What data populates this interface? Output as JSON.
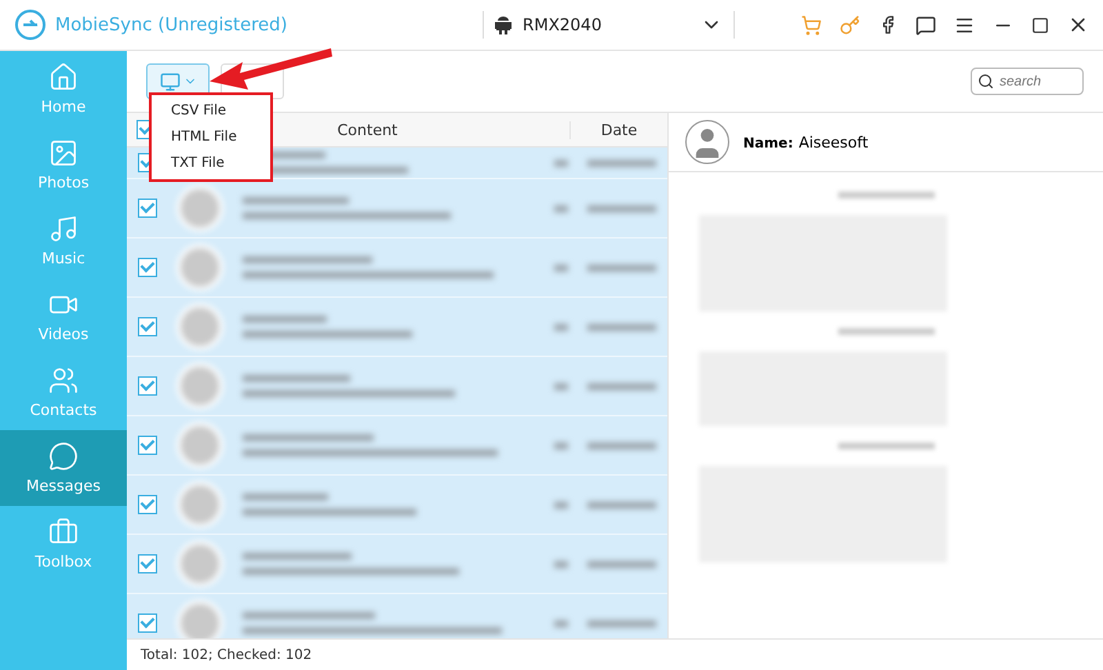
{
  "window": {
    "title": "MobieSync (Unregistered)",
    "device": "RMX2040"
  },
  "sidebar": {
    "items": [
      {
        "label": "Home",
        "selected": false
      },
      {
        "label": "Photos",
        "selected": false
      },
      {
        "label": "Music",
        "selected": false
      },
      {
        "label": "Videos",
        "selected": false
      },
      {
        "label": "Contacts",
        "selected": false
      },
      {
        "label": "Messages",
        "selected": true
      },
      {
        "label": "Toolbox",
        "selected": false
      }
    ]
  },
  "export_menu": {
    "expanded": true,
    "items": [
      "CSV File",
      "HTML File",
      "TXT File"
    ]
  },
  "search": {
    "placeholder": "search"
  },
  "table": {
    "columns": [
      "Content",
      "Date"
    ],
    "all_checked": true,
    "rows": [
      {
        "checked": true
      },
      {
        "checked": true
      },
      {
        "checked": true
      },
      {
        "checked": true
      },
      {
        "checked": true
      },
      {
        "checked": true
      },
      {
        "checked": true
      },
      {
        "checked": true
      },
      {
        "checked": true
      }
    ]
  },
  "conversation": {
    "name_label": "Name:",
    "name": "Aiseesoft"
  },
  "status_bar": "Total: 102; Checked: 102"
}
